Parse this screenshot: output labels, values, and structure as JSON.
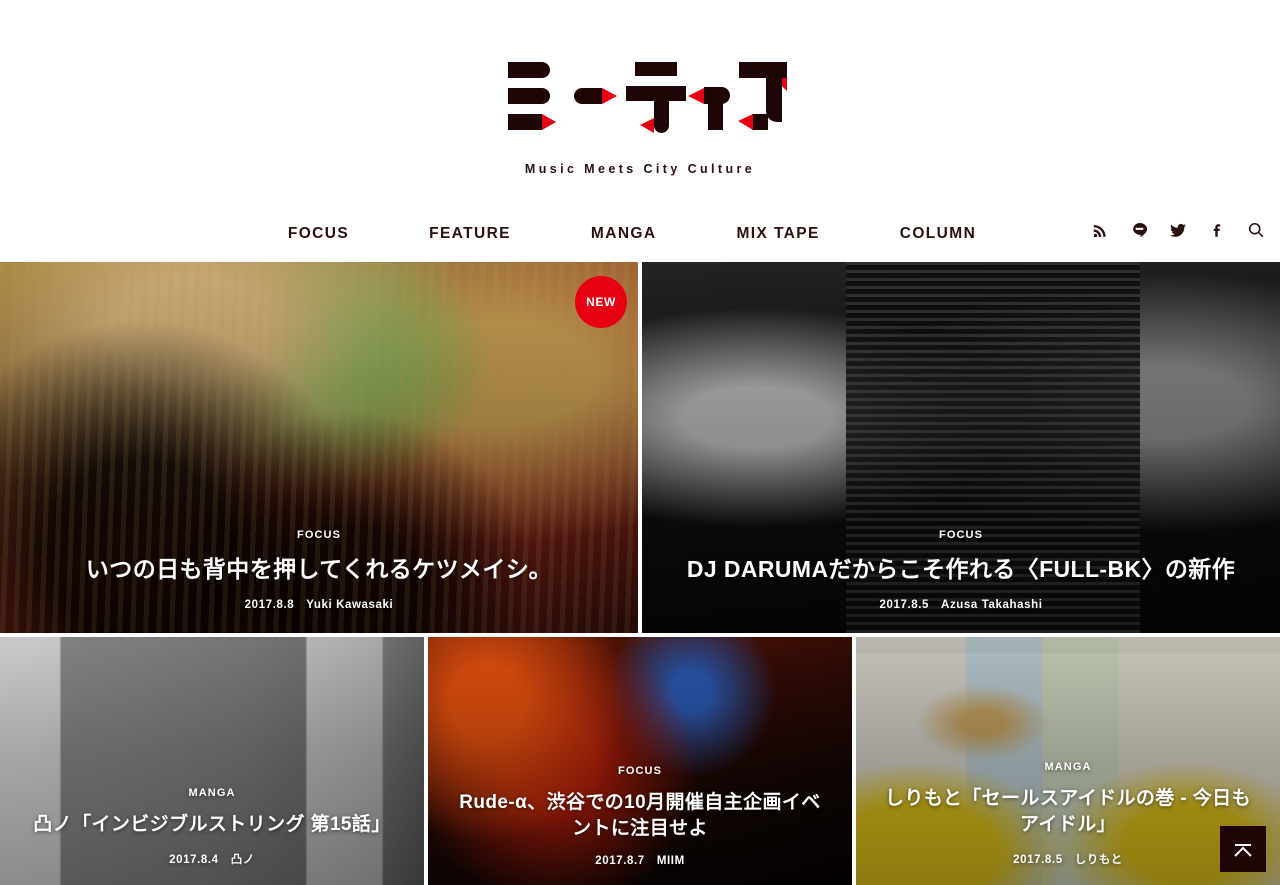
{
  "header": {
    "logo_alt": "ミーティア",
    "tagline": "Music Meets City Culture",
    "nav": [
      {
        "label": "FOCUS",
        "name": "nav-focus"
      },
      {
        "label": "FEATURE",
        "name": "nav-feature"
      },
      {
        "label": "MANGA",
        "name": "nav-manga"
      },
      {
        "label": "MIX TAPE",
        "name": "nav-mixtape"
      },
      {
        "label": "COLUMN",
        "name": "nav-column"
      }
    ],
    "social": [
      {
        "icon": "rss-icon",
        "label": "RSS"
      },
      {
        "icon": "line-icon",
        "label": "LINE"
      },
      {
        "icon": "twitter-icon",
        "label": "Twitter"
      },
      {
        "icon": "facebook-icon",
        "label": "Facebook"
      },
      {
        "icon": "search-icon",
        "label": "Search"
      }
    ]
  },
  "colors": {
    "brand_dark": "#1e0606",
    "brand_red": "#e60012",
    "page_bg": "#ffffff",
    "text_on_photo": "#ffffff"
  },
  "badges": {
    "new_label": "NEW"
  },
  "cards": [
    {
      "category": "FOCUS",
      "title": "いつの日も背中を押してくれるケツメイシ。",
      "date": "2017.8.8",
      "author": "Yuki Kawasaki",
      "is_new": true
    },
    {
      "category": "FOCUS",
      "title": "DJ DARUMAだからこそ作れる〈FULL-BK〉の新作",
      "date": "2017.8.5",
      "author": "Azusa Takahashi",
      "is_new": false
    },
    {
      "category": "MANGA",
      "title": "凸ノ「インビジブルストリング 第15話」",
      "date": "2017.8.4",
      "author": "凸ノ",
      "is_new": false
    },
    {
      "category": "FOCUS",
      "title": "Rude-α、渋谷での10月開催自主企画イベントに注目せよ",
      "date": "2017.8.7",
      "author": "MIIM",
      "is_new": false
    },
    {
      "category": "MANGA",
      "title": "しりもと「セールスアイドルの巻 - 今日もアイドル」",
      "date": "2017.8.5",
      "author": "しりもと",
      "is_new": false
    }
  ],
  "back_to_top": {
    "icon": "chevron-up-icon",
    "label": "PAGE TOP"
  }
}
